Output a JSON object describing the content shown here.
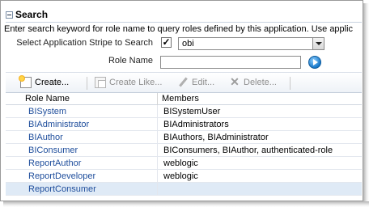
{
  "panel": {
    "title": "Search",
    "instructions": "Enter search keyword for role name to query roles defined by this application. Use applic"
  },
  "form": {
    "stripe_label": "Select Application Stripe to Search",
    "stripe_checked": "✓",
    "stripe_value": "obi",
    "role_label": "Role Name",
    "role_value": ""
  },
  "toolbar": {
    "create": "Create...",
    "create_like": "Create Like...",
    "edit": "Edit...",
    "delete": "Delete..."
  },
  "table": {
    "columns": [
      "Role Name",
      "Members"
    ],
    "rows": [
      {
        "role": "BISystem",
        "members": "BISystemUser"
      },
      {
        "role": "BIAdministrator",
        "members": "BIAdministrators"
      },
      {
        "role": "BIAuthor",
        "members": "BIAuthors, BIAdministrator"
      },
      {
        "role": "BIConsumer",
        "members": "BIConsumers, BIAuthor, authenticated-role"
      },
      {
        "role": "ReportAuthor",
        "members": "weblogic"
      },
      {
        "role": "ReportDeveloper",
        "members": "weblogic"
      },
      {
        "role": "ReportConsumer",
        "members": ""
      }
    ],
    "selected_row": "ReportConsumer"
  },
  "colors": {
    "link": "#1f4e9c",
    "selection": "#dfeaf6"
  }
}
